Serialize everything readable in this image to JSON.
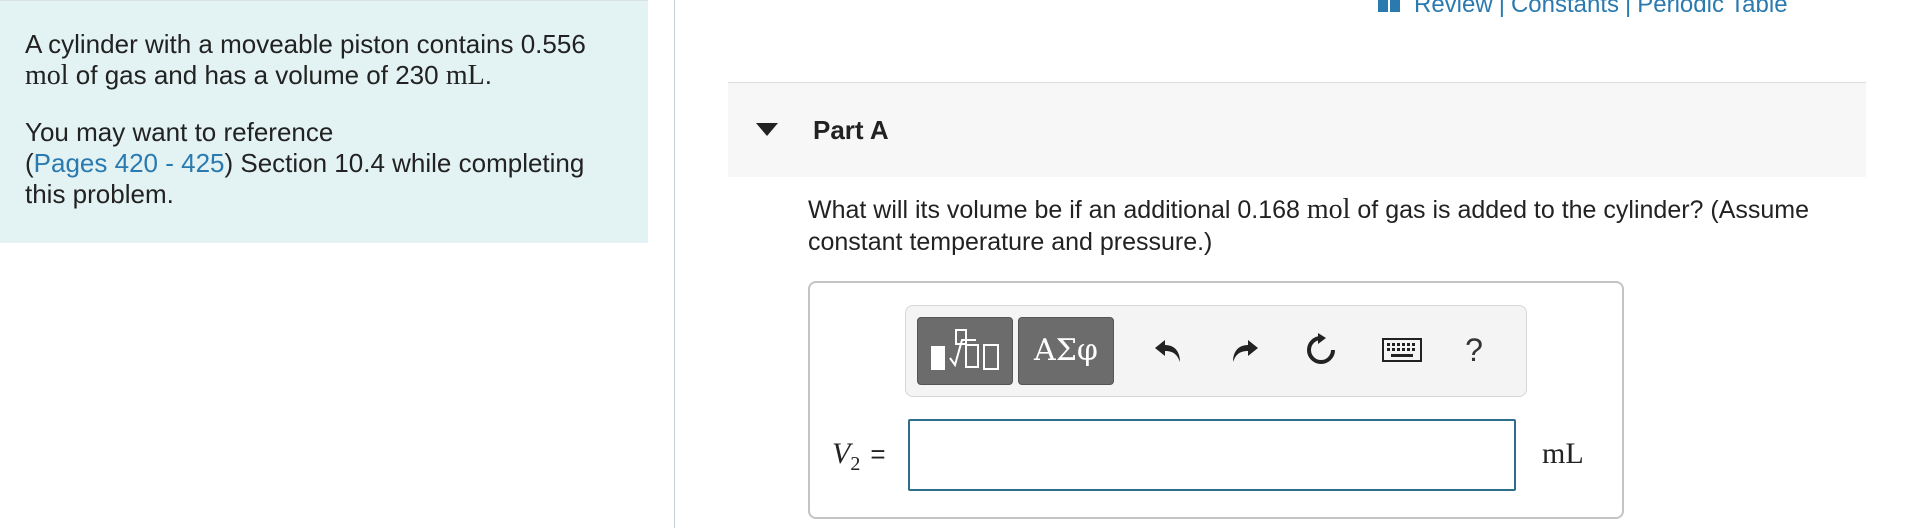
{
  "problem": {
    "intro_pre": "A cylinder with a moveable piston contains 0.556",
    "intro_unit_mol": "mol",
    "intro_mid": " of gas and has a volume of 230",
    "intro_unit_ml": "mL",
    "intro_end": ".",
    "ref_pre": "You may want to reference",
    "ref_open": "(",
    "ref_link": "Pages 420 - 425",
    "ref_post": ") Section 10.4 while completing this problem."
  },
  "top_links": {
    "review": "Review",
    "sep1": "|",
    "constants": "Constants",
    "sep2": "|",
    "periodic": "Periodic Table",
    "book_icon": "book-icon"
  },
  "part": {
    "title": "Part A",
    "question_pre": "What will its volume be if an additional 0.168",
    "question_unit": "mol",
    "question_post": " of gas is added to the cylinder? (Assume constant temperature and pressure.)"
  },
  "toolbar": {
    "greek_label": "ΑΣφ",
    "help_label": "?",
    "icons": [
      "templates-icon",
      "greek-letters-icon",
      "undo-icon",
      "redo-icon",
      "reset-icon",
      "keyboard-icon",
      "help-icon"
    ]
  },
  "answer": {
    "var_symbol": "V",
    "var_subscript": "2",
    "equals": "=",
    "input_value": "",
    "unit": "mL"
  },
  "colors": {
    "left_panel_bg": "#e3f2f2",
    "link": "#2a7ab0",
    "input_border": "#2e6e8c",
    "toolbar_button": "#6c6c6c"
  }
}
